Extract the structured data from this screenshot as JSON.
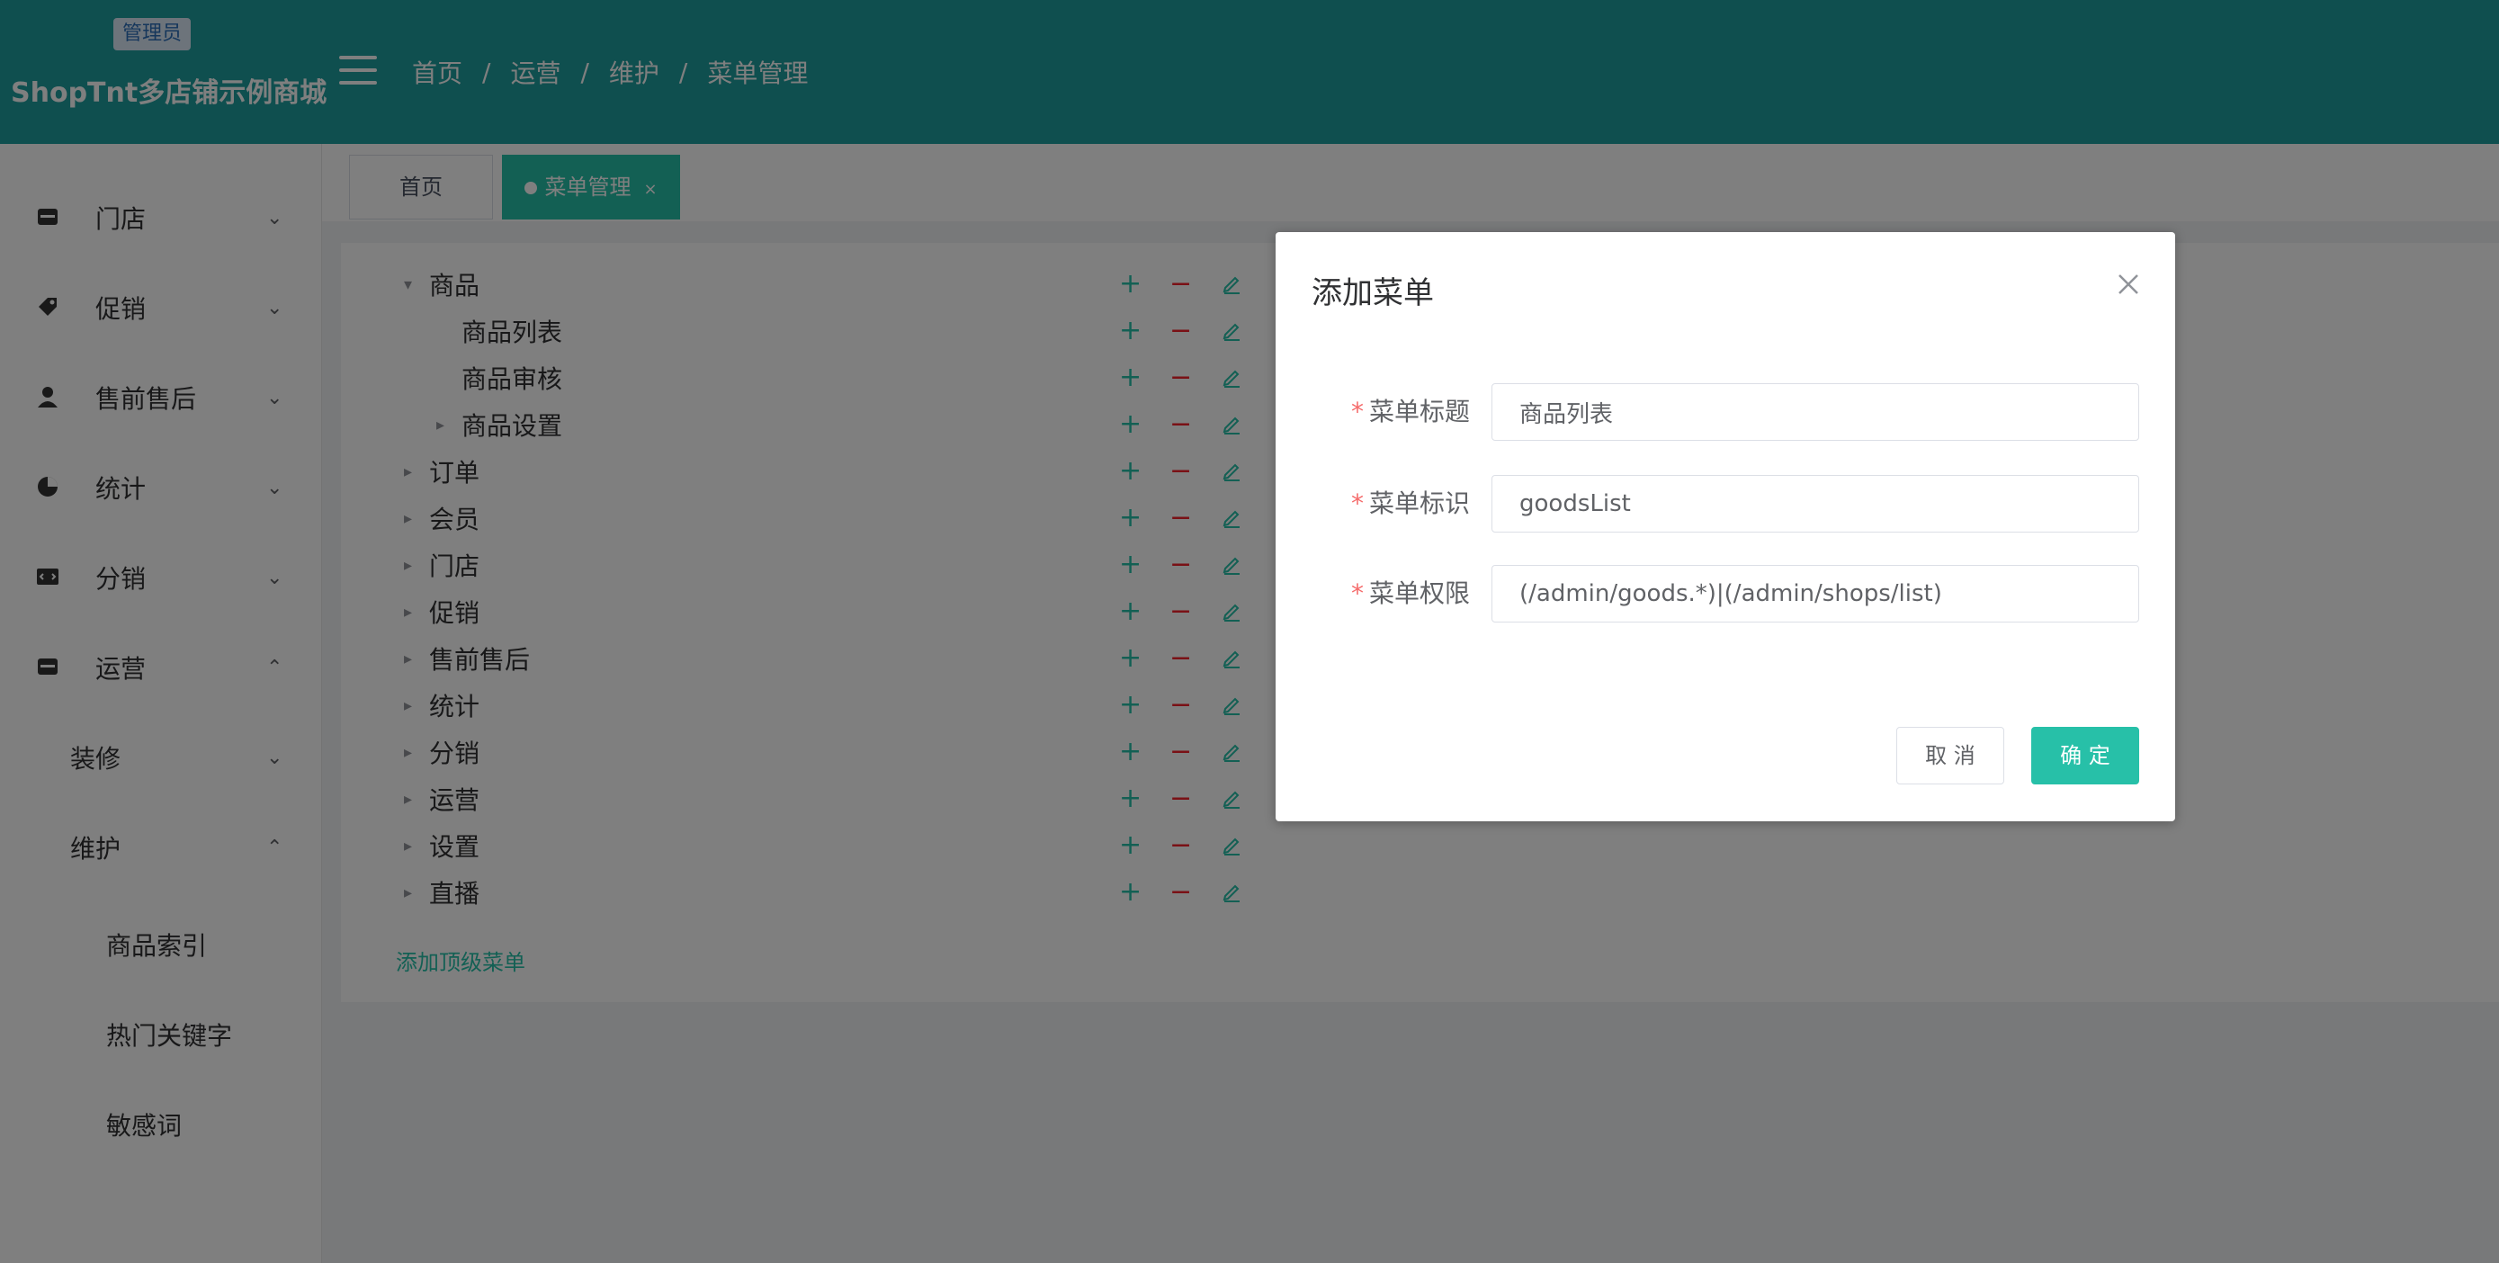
{
  "header": {
    "badge": "管理员",
    "brand_title": "ShopTnt多店铺示例商城",
    "breadcrumb": [
      "首页",
      "运营",
      "维护",
      "菜单管理"
    ]
  },
  "sidebar": {
    "items": [
      {
        "label": "门店",
        "icon": "store-icon"
      },
      {
        "label": "促销",
        "icon": "tag-icon"
      },
      {
        "label": "售前售后",
        "icon": "user-icon"
      },
      {
        "label": "统计",
        "icon": "pie-chart-icon"
      },
      {
        "label": "分销",
        "icon": "code-icon"
      },
      {
        "label": "运营",
        "icon": "store-icon"
      }
    ],
    "sub_items": [
      "装修",
      "维护"
    ],
    "leaf_items": [
      "商品索引",
      "热门关键字",
      "敏感词"
    ]
  },
  "tabs": [
    {
      "label": "首页"
    },
    {
      "label": "菜单管理",
      "close": "×"
    }
  ],
  "tree": {
    "rows": [
      "商品",
      "商品列表",
      "商品审核",
      "商品设置",
      "订单",
      "会员",
      "门店",
      "促销",
      "售前售后",
      "统计",
      "分销",
      "运营",
      "设置",
      "直播"
    ],
    "add_top_label": "添加顶级菜单"
  },
  "dialog": {
    "title": "添加菜单",
    "fields": [
      {
        "label": "菜单标题",
        "value": "商品列表"
      },
      {
        "label": "菜单标识",
        "value": "goodsList"
      },
      {
        "label": "菜单权限",
        "value": "(/admin/goods.*)|(/admin/shops/list)"
      }
    ],
    "cancel_label": "取 消",
    "ok_label": "确 定"
  },
  "colors": {
    "accent": "#27c0a8",
    "header": "#1f9e9e",
    "danger": "#f56c6c"
  }
}
